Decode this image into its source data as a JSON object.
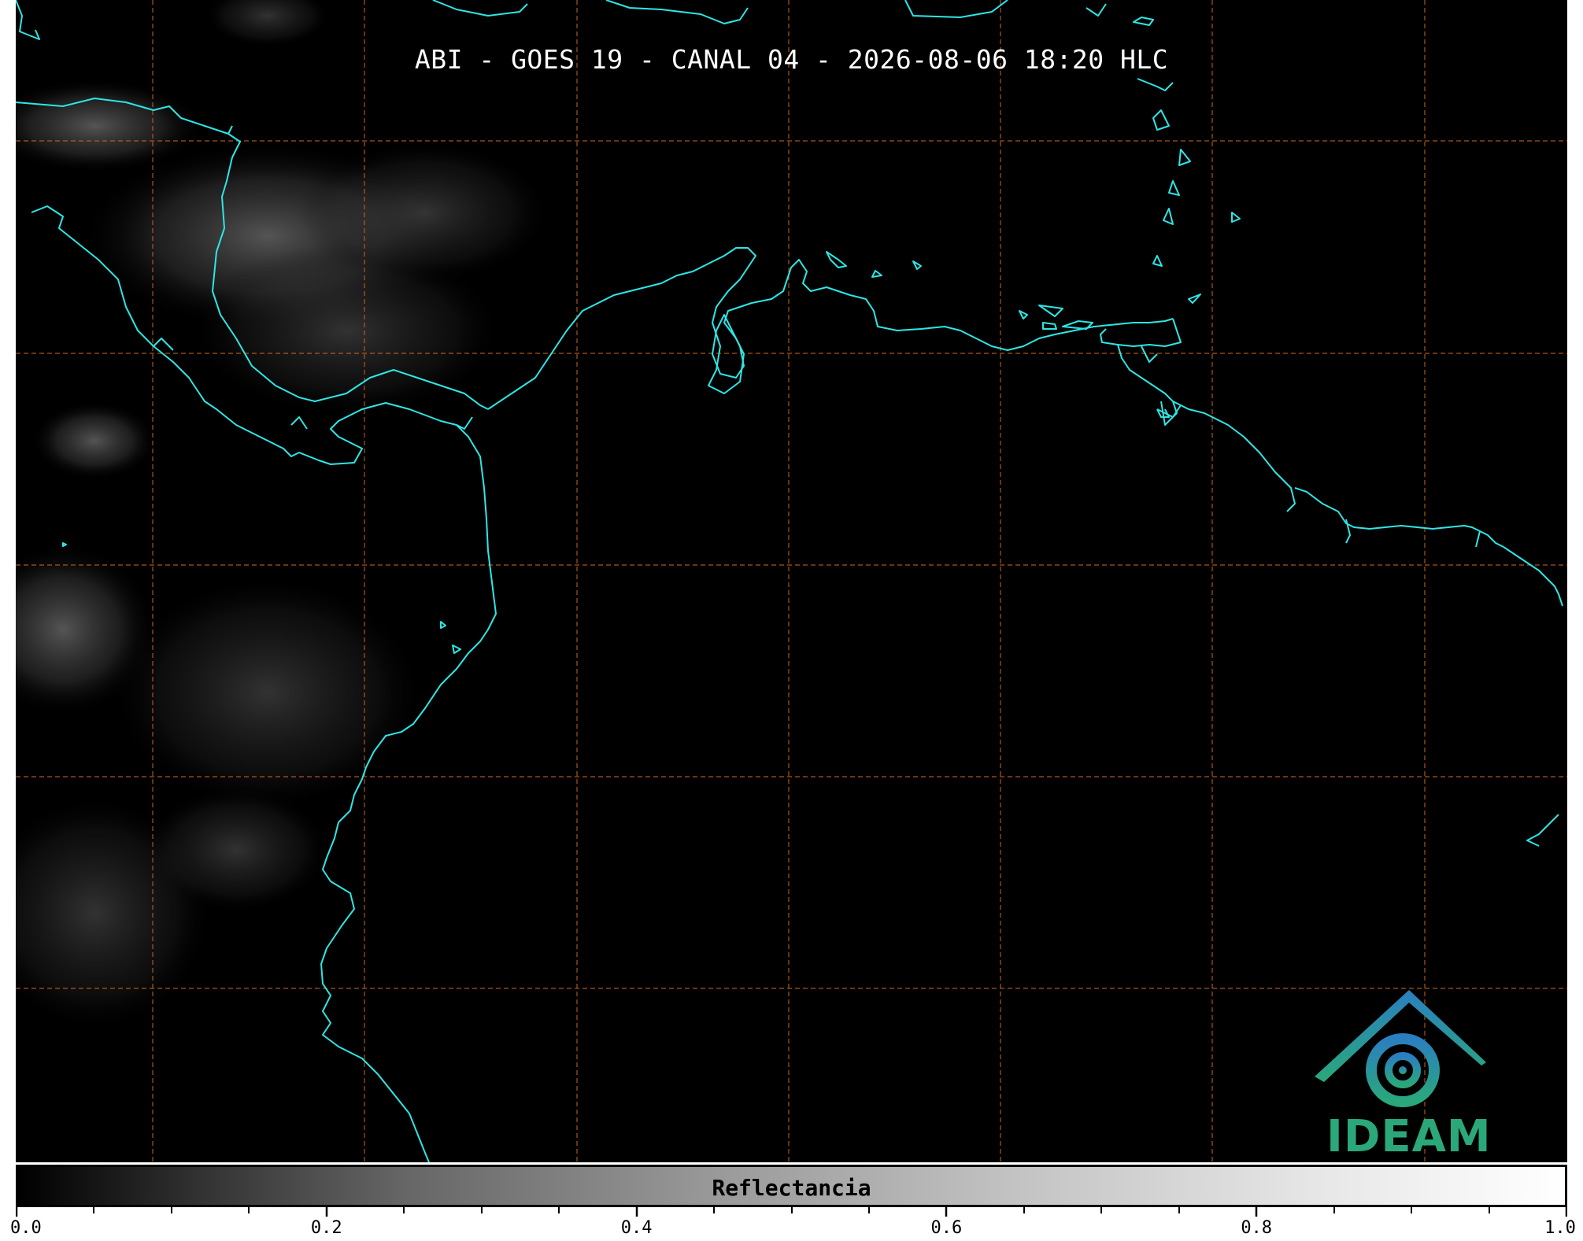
{
  "title": "ABI - GOES 19 - CANAL 04 - 2026-08-06 18:20 HLC",
  "colorbar": {
    "label": "Reflectancia",
    "ticks": [
      "0.0",
      "0.2",
      "0.4",
      "0.6",
      "0.8",
      "1.0"
    ],
    "range": [
      0.0,
      1.0
    ],
    "colormap": [
      "#000000",
      "#ffffff"
    ]
  },
  "logo": {
    "text": "IDEAM"
  },
  "colors": {
    "coastline": "#2ee6e6",
    "gridlines": "#c8641e",
    "background": "#000000",
    "logo_green": "#2aa87a",
    "logo_blue": "#2a7fc0"
  }
}
